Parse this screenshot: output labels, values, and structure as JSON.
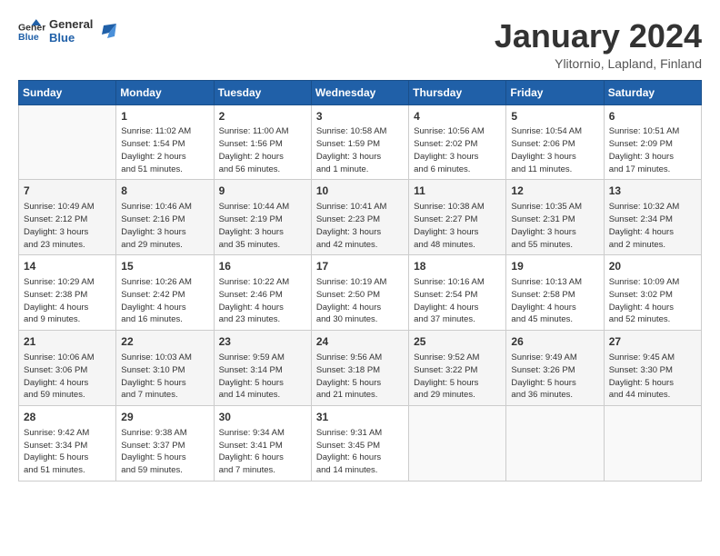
{
  "header": {
    "logo_general": "General",
    "logo_blue": "Blue",
    "month_title": "January 2024",
    "subtitle": "Ylitornio, Lapland, Finland"
  },
  "weekdays": [
    "Sunday",
    "Monday",
    "Tuesday",
    "Wednesday",
    "Thursday",
    "Friday",
    "Saturday"
  ],
  "weeks": [
    [
      {
        "day": "",
        "info": ""
      },
      {
        "day": "1",
        "info": "Sunrise: 11:02 AM\nSunset: 1:54 PM\nDaylight: 2 hours\nand 51 minutes."
      },
      {
        "day": "2",
        "info": "Sunrise: 11:00 AM\nSunset: 1:56 PM\nDaylight: 2 hours\nand 56 minutes."
      },
      {
        "day": "3",
        "info": "Sunrise: 10:58 AM\nSunset: 1:59 PM\nDaylight: 3 hours\nand 1 minute."
      },
      {
        "day": "4",
        "info": "Sunrise: 10:56 AM\nSunset: 2:02 PM\nDaylight: 3 hours\nand 6 minutes."
      },
      {
        "day": "5",
        "info": "Sunrise: 10:54 AM\nSunset: 2:06 PM\nDaylight: 3 hours\nand 11 minutes."
      },
      {
        "day": "6",
        "info": "Sunrise: 10:51 AM\nSunset: 2:09 PM\nDaylight: 3 hours\nand 17 minutes."
      }
    ],
    [
      {
        "day": "7",
        "info": "Sunrise: 10:49 AM\nSunset: 2:12 PM\nDaylight: 3 hours\nand 23 minutes."
      },
      {
        "day": "8",
        "info": "Sunrise: 10:46 AM\nSunset: 2:16 PM\nDaylight: 3 hours\nand 29 minutes."
      },
      {
        "day": "9",
        "info": "Sunrise: 10:44 AM\nSunset: 2:19 PM\nDaylight: 3 hours\nand 35 minutes."
      },
      {
        "day": "10",
        "info": "Sunrise: 10:41 AM\nSunset: 2:23 PM\nDaylight: 3 hours\nand 42 minutes."
      },
      {
        "day": "11",
        "info": "Sunrise: 10:38 AM\nSunset: 2:27 PM\nDaylight: 3 hours\nand 48 minutes."
      },
      {
        "day": "12",
        "info": "Sunrise: 10:35 AM\nSunset: 2:31 PM\nDaylight: 3 hours\nand 55 minutes."
      },
      {
        "day": "13",
        "info": "Sunrise: 10:32 AM\nSunset: 2:34 PM\nDaylight: 4 hours\nand 2 minutes."
      }
    ],
    [
      {
        "day": "14",
        "info": "Sunrise: 10:29 AM\nSunset: 2:38 PM\nDaylight: 4 hours\nand 9 minutes."
      },
      {
        "day": "15",
        "info": "Sunrise: 10:26 AM\nSunset: 2:42 PM\nDaylight: 4 hours\nand 16 minutes."
      },
      {
        "day": "16",
        "info": "Sunrise: 10:22 AM\nSunset: 2:46 PM\nDaylight: 4 hours\nand 23 minutes."
      },
      {
        "day": "17",
        "info": "Sunrise: 10:19 AM\nSunset: 2:50 PM\nDaylight: 4 hours\nand 30 minutes."
      },
      {
        "day": "18",
        "info": "Sunrise: 10:16 AM\nSunset: 2:54 PM\nDaylight: 4 hours\nand 37 minutes."
      },
      {
        "day": "19",
        "info": "Sunrise: 10:13 AM\nSunset: 2:58 PM\nDaylight: 4 hours\nand 45 minutes."
      },
      {
        "day": "20",
        "info": "Sunrise: 10:09 AM\nSunset: 3:02 PM\nDaylight: 4 hours\nand 52 minutes."
      }
    ],
    [
      {
        "day": "21",
        "info": "Sunrise: 10:06 AM\nSunset: 3:06 PM\nDaylight: 4 hours\nand 59 minutes."
      },
      {
        "day": "22",
        "info": "Sunrise: 10:03 AM\nSunset: 3:10 PM\nDaylight: 5 hours\nand 7 minutes."
      },
      {
        "day": "23",
        "info": "Sunrise: 9:59 AM\nSunset: 3:14 PM\nDaylight: 5 hours\nand 14 minutes."
      },
      {
        "day": "24",
        "info": "Sunrise: 9:56 AM\nSunset: 3:18 PM\nDaylight: 5 hours\nand 21 minutes."
      },
      {
        "day": "25",
        "info": "Sunrise: 9:52 AM\nSunset: 3:22 PM\nDaylight: 5 hours\nand 29 minutes."
      },
      {
        "day": "26",
        "info": "Sunrise: 9:49 AM\nSunset: 3:26 PM\nDaylight: 5 hours\nand 36 minutes."
      },
      {
        "day": "27",
        "info": "Sunrise: 9:45 AM\nSunset: 3:30 PM\nDaylight: 5 hours\nand 44 minutes."
      }
    ],
    [
      {
        "day": "28",
        "info": "Sunrise: 9:42 AM\nSunset: 3:34 PM\nDaylight: 5 hours\nand 51 minutes."
      },
      {
        "day": "29",
        "info": "Sunrise: 9:38 AM\nSunset: 3:37 PM\nDaylight: 5 hours\nand 59 minutes."
      },
      {
        "day": "30",
        "info": "Sunrise: 9:34 AM\nSunset: 3:41 PM\nDaylight: 6 hours\nand 7 minutes."
      },
      {
        "day": "31",
        "info": "Sunrise: 9:31 AM\nSunset: 3:45 PM\nDaylight: 6 hours\nand 14 minutes."
      },
      {
        "day": "",
        "info": ""
      },
      {
        "day": "",
        "info": ""
      },
      {
        "day": "",
        "info": ""
      }
    ]
  ]
}
